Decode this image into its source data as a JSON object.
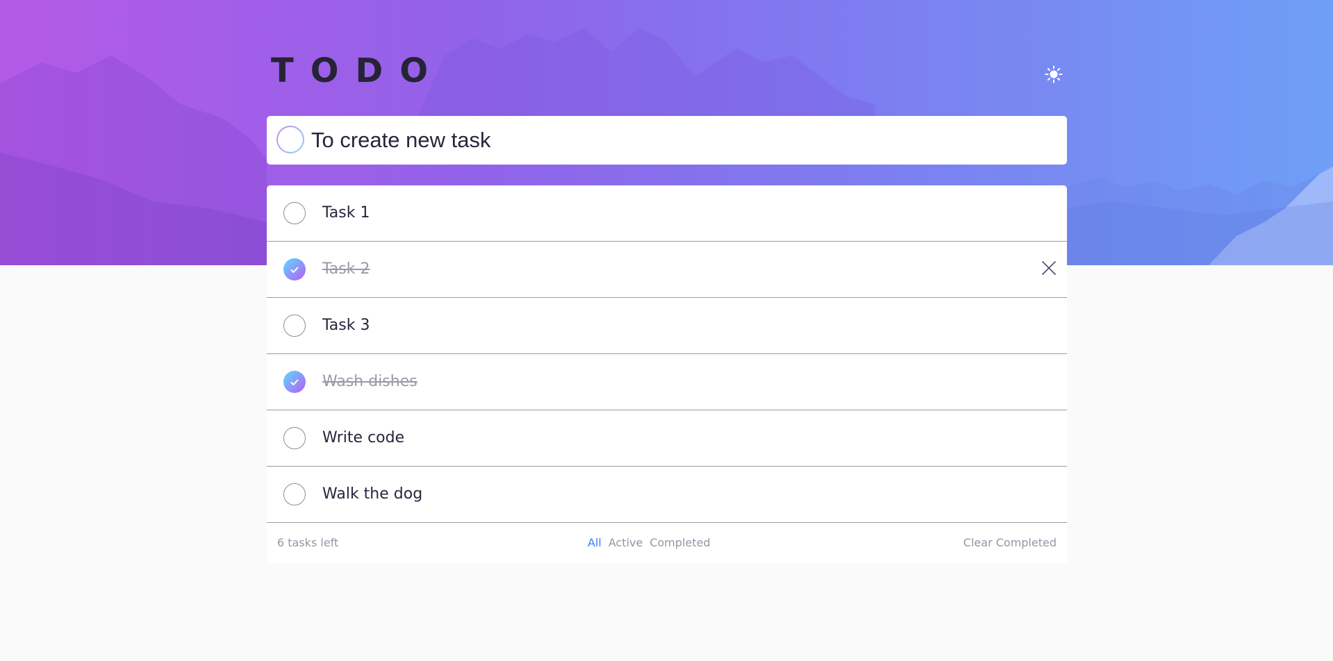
{
  "app": {
    "title": "TODO"
  },
  "new_task": {
    "placeholder": "To create new task"
  },
  "tasks": [
    {
      "label": "Task 1",
      "completed": false
    },
    {
      "label": "Task 2",
      "completed": true
    },
    {
      "label": "Task 3",
      "completed": false
    },
    {
      "label": "Wash dishes",
      "completed": true
    },
    {
      "label": "Write code",
      "completed": false
    },
    {
      "label": "Walk the dog",
      "completed": false
    }
  ],
  "footer": {
    "count_text": "6 tasks left",
    "filters": {
      "all": "All",
      "active": "Active",
      "completed": "Completed"
    },
    "active_filter": "All",
    "clear_label": "Clear Completed"
  },
  "icons": {
    "theme": "sun-icon",
    "check": "check-icon",
    "delete": "close-icon"
  },
  "colors": {
    "accent": "#3a7cfd",
    "check_gradient_start": "#55ddff",
    "check_gradient_end": "#c058f3",
    "text": "#25273c",
    "muted": "#9495a5"
  }
}
